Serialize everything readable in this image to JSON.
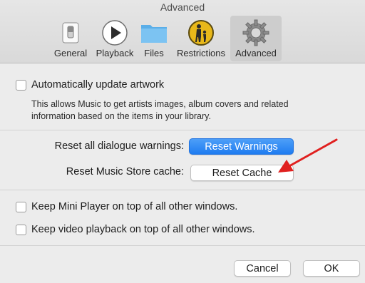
{
  "window": {
    "title": "Advanced"
  },
  "tabs": [
    {
      "label": "General",
      "icon": "switch-icon"
    },
    {
      "label": "Playback",
      "icon": "play-icon"
    },
    {
      "label": "Files",
      "icon": "folder-icon"
    },
    {
      "label": "Restrictions",
      "icon": "parental-icon"
    },
    {
      "label": "Advanced",
      "icon": "gear-icon",
      "active": true
    }
  ],
  "artwork": {
    "checkbox_label": "Automatically update artwork",
    "checked": false,
    "description_line1": "This allows Music to get artists images, album covers and related",
    "description_line2": "information based on the items in your library."
  },
  "reset": {
    "warnings_label": "Reset all dialogue warnings:",
    "warnings_button": "Reset Warnings",
    "cache_label": "Reset Music Store cache:",
    "cache_button": "Reset Cache"
  },
  "options": {
    "mini_player_label": "Keep Mini Player on top of all other windows.",
    "video_label": "Keep video playback on top of all other windows."
  },
  "footer": {
    "cancel": "Cancel",
    "ok": "OK"
  },
  "colors": {
    "primary": "#1f7cf0",
    "annotation_arrow": "#e0201f"
  }
}
